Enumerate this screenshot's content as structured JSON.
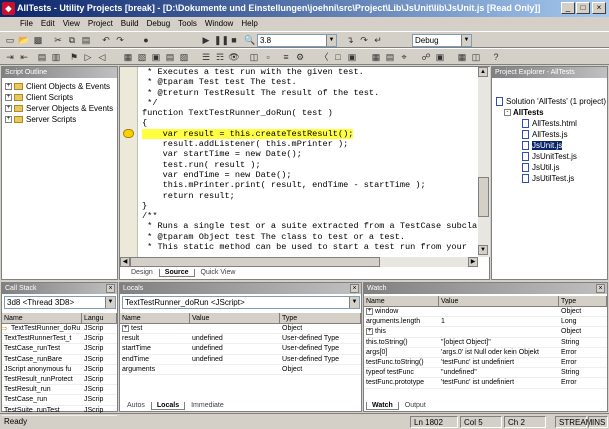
{
  "window": {
    "title": "AllTests - Utility Projects [break] - [D:\\Dokumente und Einstellungen\\joehni\\src\\Project\\Lib\\JsUnit\\lib\\JsUnit.js [Read Only]]"
  },
  "menu": [
    "File",
    "Edit",
    "View",
    "Project",
    "Build",
    "Debug",
    "Tools",
    "Window",
    "Help"
  ],
  "toolbar": {
    "find_value": "3.8",
    "config_value": "Debug"
  },
  "script_outline": {
    "title": "Script Outline",
    "items": [
      "Client Objects & Events",
      "Client Scripts",
      "Server Objects & Events",
      "Server Scripts"
    ]
  },
  "editor": {
    "lines": [
      " * Executes a test run with the given test.",
      " * @tparam Test test The test.",
      " * @treturn TestResult The result of the test.",
      " */",
      "function TextTestRunner_doRun( test )",
      "{",
      "    var result = this.createTestResult();",
      "    result.addListener( this.mPrinter );",
      "    var startTime = new Date();",
      "    test.run( result );",
      "    var endTime = new Date();",
      "    this.mPrinter.print( result, endTime - startTime );",
      "    return result;",
      "}",
      "/**",
      " * Runs a single test or a suite extracted from a TestCase subcla",
      " * @tparam Object test The class to test or a test.",
      " * This static method can be used to start a test run from your"
    ],
    "current_line": 6,
    "tabs": [
      "Design",
      "Source",
      "Quick View"
    ]
  },
  "project_explorer": {
    "title": "Project Explorer - AllTests",
    "solution": "Solution 'AllTests' (1 project)",
    "project": "AllTests",
    "files": [
      "AllTests.html",
      "AllTests.js",
      "JsUnit.js",
      "JsUnitTest.js",
      "JsUtil.js",
      "JsUtilTest.js"
    ],
    "selected_file": "JsUnit.js"
  },
  "call_stack": {
    "title": "Call Stack",
    "thread": "3d8  <Thread 3D8>",
    "columns": [
      "Name",
      "Langu"
    ],
    "rows": [
      [
        "TextTestRunner_doRu",
        "JScrip"
      ],
      [
        "TextTestRunnerTest_t",
        "JScrip"
      ],
      [
        "TestCase_runTest",
        "JScrip"
      ],
      [
        "TestCase_runBare",
        "JScrip"
      ],
      [
        "JScript anonymous fu",
        "JScrip"
      ],
      [
        "TestResult_runProtect",
        "JScrip"
      ],
      [
        "TestResult_run",
        "JScrip"
      ],
      [
        "TestCase_run",
        "JScrip"
      ],
      [
        "TestSuite_runTest",
        "JScrip"
      ]
    ]
  },
  "locals": {
    "title": "Locals",
    "context": "TextTestRunner_doRun  <JScript>",
    "columns": [
      "Name",
      "Value",
      "Type"
    ],
    "rows": [
      [
        "test",
        "",
        "Object"
      ],
      [
        "result",
        "undefined",
        "User-defined Type"
      ],
      [
        "startTime",
        "undefined",
        "User-defined Type"
      ],
      [
        "endTime",
        "undefined",
        "User-defined Type"
      ],
      [
        "arguments",
        "",
        "Object"
      ]
    ],
    "tabs": [
      "Autos",
      "Locals",
      "Immediate"
    ]
  },
  "watch": {
    "title": "Watch",
    "columns": [
      "Name",
      "Value",
      "Type"
    ],
    "rows": [
      [
        "window",
        "",
        "Object"
      ],
      [
        "arguments.length",
        "1",
        "Long"
      ],
      [
        "this",
        "",
        "Object"
      ],
      [
        "this.toString()",
        "\"[object Object]\"",
        "String"
      ],
      [
        "args[0]",
        "'args.0' ist Null oder kein Objekt",
        "Error"
      ],
      [
        "testFunc.toString()",
        "'testFunc' ist undefiniert",
        "Error"
      ],
      [
        "typeof testFunc",
        "\"undefined\"",
        "String"
      ],
      [
        "testFunc.prototype",
        "'testFunc' ist undefiniert",
        "Error"
      ]
    ],
    "tabs": [
      "Watch",
      "Output"
    ]
  },
  "status": {
    "text": "Ready",
    "line": "Ln 1802",
    "col": "Col 5",
    "ch": "Ch 2",
    "stream": "STREAM",
    "ins": "INS"
  }
}
